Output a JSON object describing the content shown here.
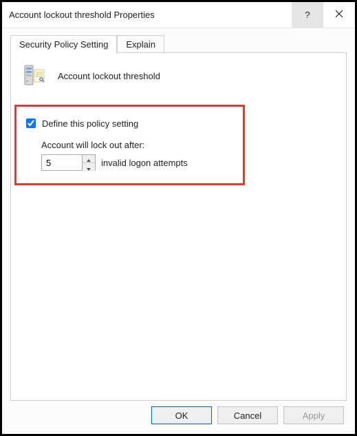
{
  "window": {
    "title": "Account lockout threshold Properties",
    "help_symbol": "?",
    "close_symbol": ""
  },
  "tabs": {
    "security": "Security Policy Setting",
    "explain": "Explain"
  },
  "policy": {
    "name": "Account lockout threshold"
  },
  "define": {
    "checkbox_label": "Define this policy setting",
    "checked": true,
    "lockout_label": "Account will lock out after:",
    "value": "5",
    "unit": "invalid logon attempts"
  },
  "buttons": {
    "ok": "OK",
    "cancel": "Cancel",
    "apply": "Apply"
  }
}
